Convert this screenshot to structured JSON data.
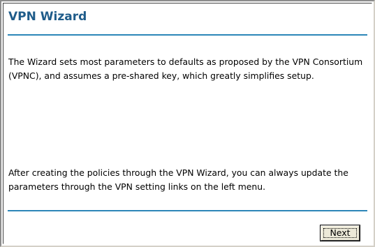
{
  "wizard": {
    "title": "VPN Wizard",
    "intro_text": "The Wizard sets most parameters to defaults as proposed by the VPN Consortium (VPNC), and assumes a pre-shared key, which greatly simplifies setup.",
    "followup_text": "After creating the policies through the VPN Wizard, you can always update the parameters through the VPN setting links on the left menu.",
    "next_label": "Next"
  },
  "colors": {
    "title": "#1f5c8a",
    "rule": "#2c86b8",
    "button_face": "#ece9d8"
  }
}
